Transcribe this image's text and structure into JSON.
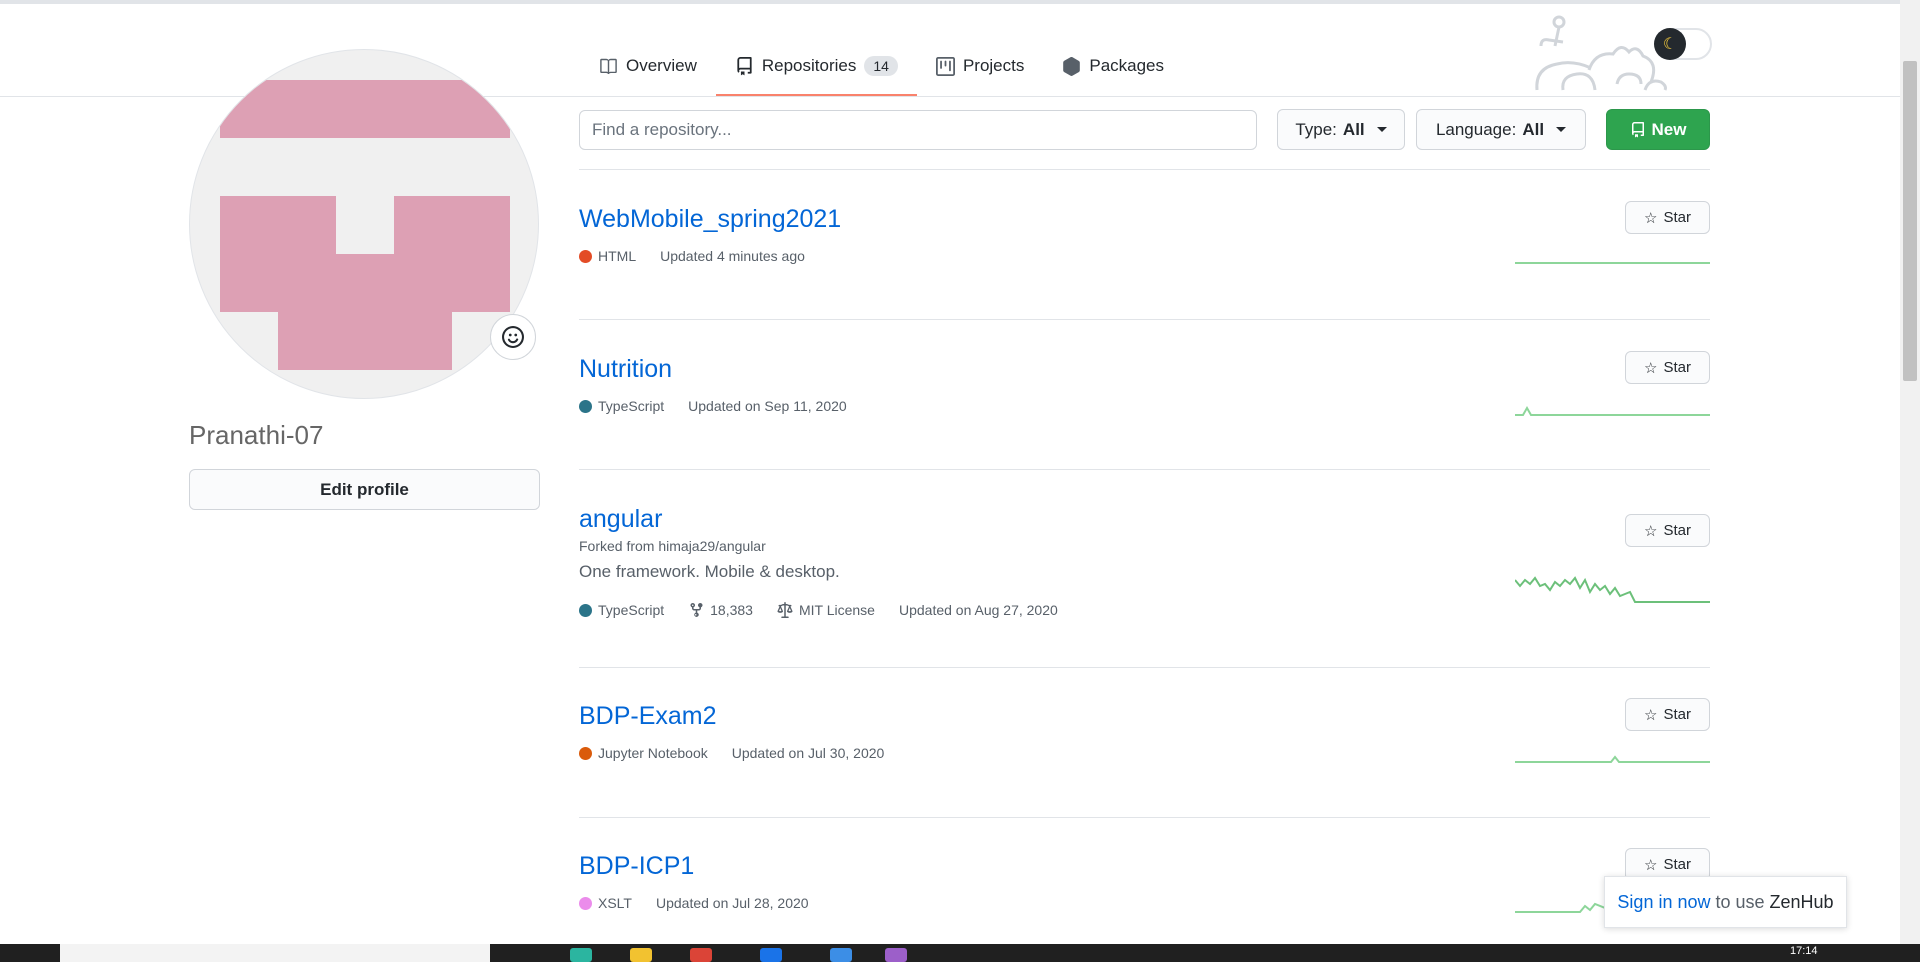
{
  "tabs": [
    {
      "label": "Overview",
      "icon": "book-icon"
    },
    {
      "label": "Repositories",
      "icon": "repo-icon",
      "count": "14",
      "active": true
    },
    {
      "label": "Projects",
      "icon": "project-icon"
    },
    {
      "label": "Packages",
      "icon": "package-icon"
    }
  ],
  "profile": {
    "username": "Pranathi-07",
    "edit_label": "Edit profile",
    "avatar_color": "#dda0b4"
  },
  "filters": {
    "search_placeholder": "Find a repository...",
    "type_label": "Type:",
    "type_value": "All",
    "language_label": "Language:",
    "language_value": "All",
    "new_label": "New"
  },
  "repos": [
    {
      "name": "WebMobile_spring2021",
      "language": "HTML",
      "language_color": "#e34c26",
      "updated": "Updated 4 minutes ago",
      "star_label": "Star"
    },
    {
      "name": "Nutrition",
      "language": "TypeScript",
      "language_color": "#2b7489",
      "updated": "Updated on Sep 11, 2020",
      "star_label": "Star"
    },
    {
      "name": "angular",
      "forked_from": "Forked from himaja29/angular",
      "description": "One framework. Mobile & desktop.",
      "language": "TypeScript",
      "language_color": "#2b7489",
      "forks": "18,383",
      "license": "MIT License",
      "updated": "Updated on Aug 27, 2020",
      "star_label": "Star"
    },
    {
      "name": "BDP-Exam2",
      "language": "Jupyter Notebook",
      "language_color": "#da5b0b",
      "updated": "Updated on Jul 30, 2020",
      "star_label": "Star"
    },
    {
      "name": "BDP-ICP1",
      "language": "XSLT",
      "language_color": "#eb8ceb",
      "updated": "Updated on Jul 28, 2020",
      "star_label": "Star"
    }
  ],
  "zenhub": {
    "link": "Sign in now",
    "middle": "to use",
    "brand": "ZenHub"
  },
  "taskbar": {
    "clock": "17:14"
  },
  "colors": {
    "accent_tab": "#f9826c",
    "link": "#0366d6",
    "new_button": "#2ea44f",
    "sparkline": "#8dd69a"
  }
}
